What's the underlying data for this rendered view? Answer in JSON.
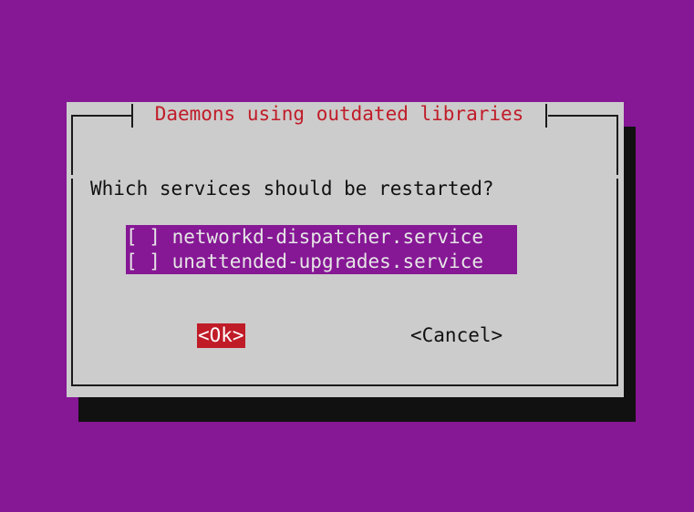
{
  "dialog": {
    "title": "Daemons using outdated libraries",
    "prompt": "Which services should be restarted?",
    "services": [
      {
        "checkbox": "[ ]",
        "label": "networkd-dispatcher.service",
        "checked": false
      },
      {
        "checkbox": "[ ]",
        "label": "unattended-upgrades.service",
        "checked": false
      }
    ],
    "buttons": {
      "ok": "<Ok>",
      "cancel": "<Cancel>"
    }
  },
  "colors": {
    "background": "#861795",
    "dialog": "#cccccc",
    "title_text": "#c01c28",
    "focused_button": "#c01c28",
    "list_background": "#861795",
    "shadow": "#111111"
  }
}
